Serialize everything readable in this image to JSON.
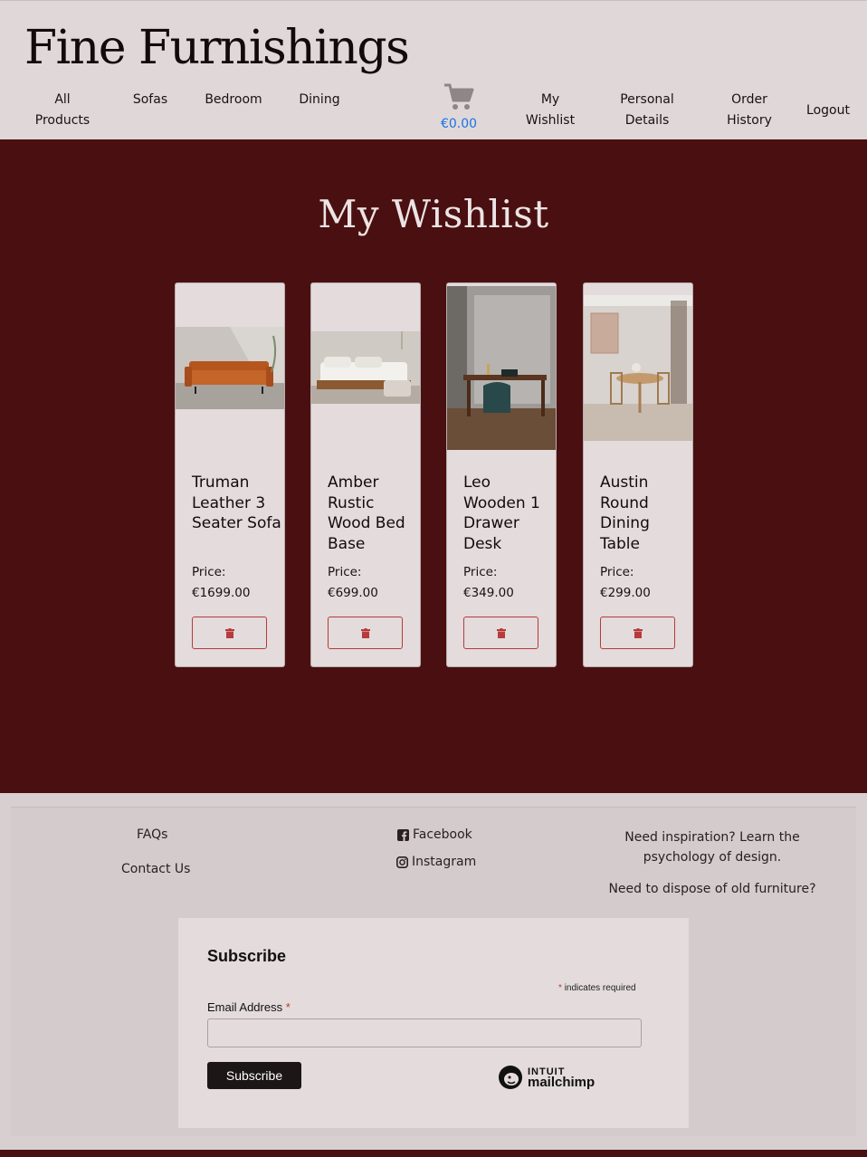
{
  "header": {
    "logo": "Fine Furnishings",
    "nav": [
      {
        "line1": "All",
        "line2": "Products"
      },
      {
        "line1": "Sofas",
        "line2": ""
      },
      {
        "line1": "Bedroom",
        "line2": ""
      },
      {
        "line1": "Dining",
        "line2": ""
      }
    ],
    "cart_total": "€0.00",
    "account": [
      {
        "line1": "My",
        "line2": "Wishlist"
      },
      {
        "line1": "Personal",
        "line2": "Details"
      },
      {
        "line1": "Order",
        "line2": "History"
      },
      {
        "line1": "Logout",
        "line2": ""
      }
    ]
  },
  "main": {
    "title": "My Wishlist",
    "products": [
      {
        "name": "Truman Leather 3 Seater Sofa",
        "price_label": "Price:",
        "price": "€1699.00",
        "image": "sofa-image"
      },
      {
        "name": "Amber Rustic Wood Bed Base",
        "price_label": "Price:",
        "price": "€699.00",
        "image": "bed-image"
      },
      {
        "name": "Leo Wooden 1 Drawer Desk",
        "price_label": "Price:",
        "price": "€349.00",
        "image": "desk-image"
      },
      {
        "name": "Austin Round Dining Table",
        "price_label": "Price:",
        "price": "€299.00",
        "image": "dining-table-image"
      }
    ]
  },
  "footer": {
    "faqs": "FAQs",
    "contact": "Contact Us",
    "facebook": "Facebook",
    "instagram": "Instagram",
    "inspiration": "Need inspiration? Learn the psychology of design.",
    "dispose": "Need to dispose of old furniture?"
  },
  "subscribe": {
    "title": "Subscribe",
    "required_note": "indicates required",
    "email_label": "Email Address",
    "button": "Subscribe",
    "brand_top": "INTUIT",
    "brand_bottom": "mailchimp"
  },
  "colors": {
    "header_bg": "#e0d8d8",
    "main_bg": "#4a0f10",
    "card_bg": "#e3dbdc",
    "remove_accent": "#b83a3a",
    "cart_price": "#1a73e8"
  }
}
